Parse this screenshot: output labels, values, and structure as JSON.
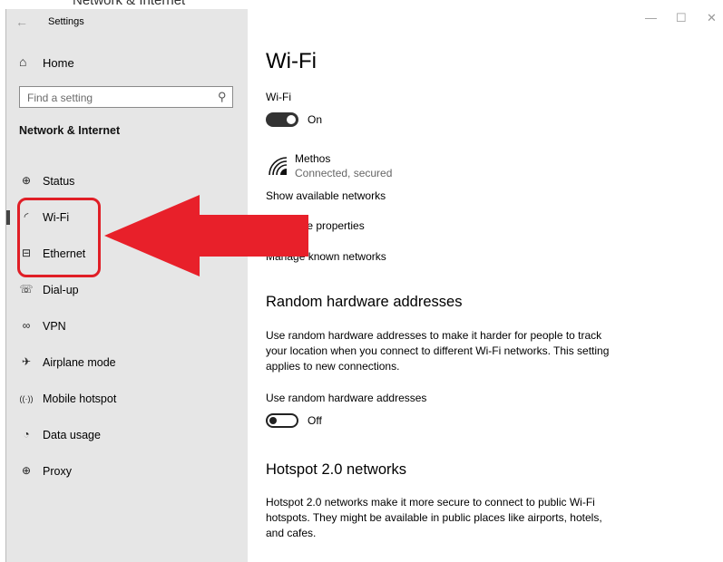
{
  "top_cut_text": "Network & Internet",
  "window": {
    "back_glyph": "←",
    "title": "Settings",
    "controls": {
      "minimize": "—",
      "maximize": "☐",
      "close": "✕"
    }
  },
  "sidebar": {
    "home": {
      "label": "Home",
      "icon": "home-icon"
    },
    "search": {
      "placeholder": "Find a setting",
      "icon": "search-icon"
    },
    "section_title": "Network & Internet",
    "items": [
      {
        "label": "Status",
        "icon": "globe-icon",
        "glyph": "⊕",
        "active": false
      },
      {
        "label": "Wi-Fi",
        "icon": "wifi-icon",
        "glyph": "◜",
        "active": true
      },
      {
        "label": "Ethernet",
        "icon": "ethernet-icon",
        "glyph": "⊟",
        "active": false
      },
      {
        "label": "Dial-up",
        "icon": "dialup-icon",
        "glyph": "☏",
        "active": false
      },
      {
        "label": "VPN",
        "icon": "vpn-icon",
        "glyph": "∞",
        "active": false
      },
      {
        "label": "Airplane mode",
        "icon": "airplane-icon",
        "glyph": "✈",
        "active": false
      },
      {
        "label": "Mobile hotspot",
        "icon": "hotspot-icon",
        "glyph": "((·))",
        "active": false
      },
      {
        "label": "Data usage",
        "icon": "data-usage-icon",
        "glyph": "◔",
        "active": false
      },
      {
        "label": "Proxy",
        "icon": "proxy-icon",
        "glyph": "⊕",
        "active": false
      }
    ]
  },
  "content": {
    "title": "Wi-Fi",
    "wifi_label": "Wi-Fi",
    "wifi_toggle": {
      "state": "On",
      "on": true
    },
    "network": {
      "name": "Methos",
      "status": "Connected, secured",
      "icon": "wifi-signal-icon"
    },
    "links": {
      "show_networks": "Show available networks",
      "hardware_properties": "Hardware properties",
      "manage_known": "Manage known networks"
    },
    "random_hw": {
      "heading": "Random hardware addresses",
      "description": "Use random hardware addresses to make it harder for people to track your location when you connect to different Wi-Fi networks. This setting applies to new connections.",
      "toggle_label": "Use random hardware addresses",
      "toggle": {
        "state": "Off",
        "on": false
      }
    },
    "hotspot": {
      "heading": "Hotspot 2.0 networks",
      "description": "Hotspot 2.0 networks make it more secure to connect to public Wi-Fi hotspots. They might be available in public places like airports, hotels, and cafes."
    }
  },
  "annotation": {
    "box_color": "#e01e26",
    "arrow_color": "#e8202a"
  }
}
